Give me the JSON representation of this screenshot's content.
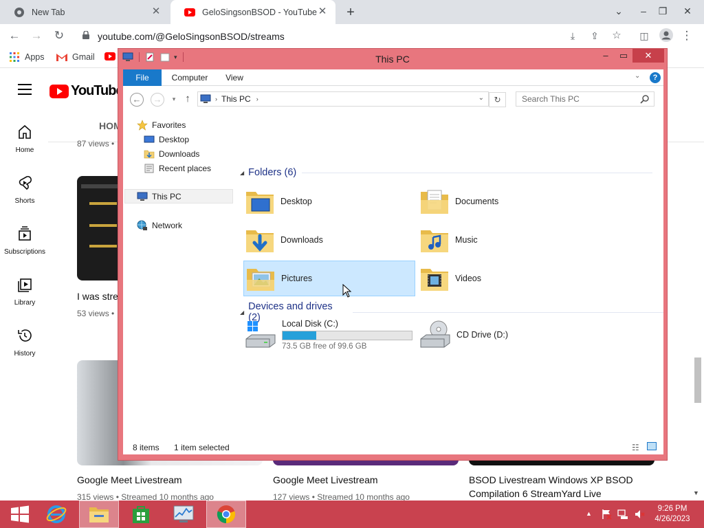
{
  "browser": {
    "tabs": [
      {
        "title": "New Tab"
      },
      {
        "title": "GeloSingsonBSOD - YouTube"
      }
    ],
    "url": "youtube.com/@GeloSingsonBSOD/streams",
    "bookmarks": [
      {
        "label": "Apps"
      },
      {
        "label": "Gmail"
      }
    ]
  },
  "youtube": {
    "logo_text": "YouTube",
    "home_tab": "HOM",
    "sidebar": [
      {
        "label": "Home"
      },
      {
        "label": "Shorts"
      },
      {
        "label": "Subscriptions"
      },
      {
        "label": "Library"
      },
      {
        "label": "History"
      }
    ],
    "row1": {
      "views_above": "87 views •",
      "title_partial": "I was stre",
      "views": "53 views •"
    },
    "videos": [
      {
        "title": "Google Meet Livestream",
        "meta": "315 views • Streamed 10 months ago"
      },
      {
        "title": "Google Meet Livestream",
        "meta": "127 views • Streamed 10 months ago"
      },
      {
        "title_line1": "BSOD Livestream Windows XP BSOD",
        "title_line2": "Compilation 6 StreamYard Live"
      }
    ]
  },
  "explorer": {
    "title": "This PC",
    "ribbon_tabs": [
      "File",
      "Computer",
      "View"
    ],
    "address": "This PC",
    "search_placeholder": "Search This PC",
    "nav": {
      "favorites": "Favorites",
      "desktop": "Desktop",
      "downloads": "Downloads",
      "recent": "Recent places",
      "thispc": "This PC",
      "network": "Network"
    },
    "folders_header": "Folders (6)",
    "folders": [
      "Desktop",
      "Documents",
      "Downloads",
      "Music",
      "Pictures",
      "Videos"
    ],
    "devices_header": "Devices and drives (2)",
    "drive_c": {
      "name": "Local Disk (C:)",
      "free": "73.5 GB free of 99.6 GB",
      "used_fraction": 0.262
    },
    "drive_d": {
      "name": "CD Drive (D:)"
    },
    "status_items": "8 items",
    "status_selected": "1 item selected"
  },
  "taskbar": {
    "time": "9:26 PM",
    "date": "4/26/2023"
  }
}
